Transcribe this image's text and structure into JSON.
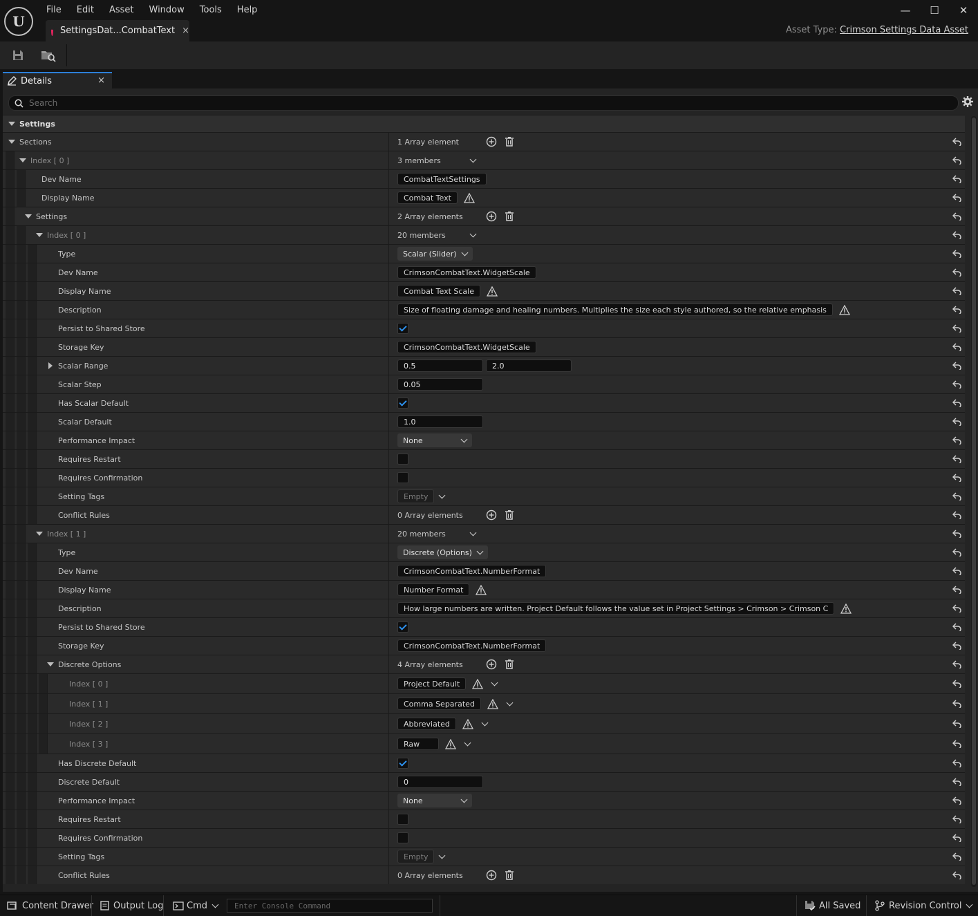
{
  "app": {
    "logo_text": "U",
    "menu": [
      "File",
      "Edit",
      "Asset",
      "Window",
      "Tools",
      "Help"
    ],
    "tab_title": "SettingsDat...CombatText",
    "tab_close": "×",
    "asset_type_label": "Asset Type:",
    "asset_type_value": "Crimson Settings Data Asset",
    "window_minimize": "—",
    "window_maximize": "☐",
    "window_close": "✕"
  },
  "details": {
    "tab_label": "Details",
    "tab_close": "×",
    "search_placeholder": "Search"
  },
  "rows": [
    {
      "depth": 0,
      "name": "Settings",
      "kind": "category",
      "arrow": "down",
      "style": "bold"
    },
    {
      "depth": 0,
      "name": "Sections",
      "arrow": "down",
      "value": {
        "type": "array",
        "text": "1 Array element"
      }
    },
    {
      "depth": 1,
      "name": "Index [ 0 ]",
      "arrow": "down",
      "style": "dim",
      "value": {
        "type": "members",
        "text": "3 members"
      }
    },
    {
      "depth": 2,
      "name": "Dev Name",
      "value": {
        "type": "text",
        "text": "CombatTextSettings"
      }
    },
    {
      "depth": 2,
      "name": "Display Name",
      "value": {
        "type": "text",
        "text": "Combat Text",
        "warn": true
      }
    },
    {
      "depth": 1.5,
      "name": "Settings",
      "arrow": "down",
      "value": {
        "type": "array",
        "text": "2 Array elements"
      }
    },
    {
      "depth": 2.5,
      "name": "Index [ 0 ]",
      "arrow": "down",
      "style": "dim",
      "value": {
        "type": "members",
        "text": "20 members"
      }
    },
    {
      "depth": 3.5,
      "name": "Type",
      "value": {
        "type": "dropdown",
        "text": "Scalar (Slider)"
      }
    },
    {
      "depth": 3.5,
      "name": "Dev Name",
      "value": {
        "type": "text",
        "text": "CrimsonCombatText.WidgetScale"
      }
    },
    {
      "depth": 3.5,
      "name": "Display Name",
      "value": {
        "type": "text",
        "text": "Combat Text Scale",
        "warn": true
      }
    },
    {
      "depth": 3.5,
      "name": "Description",
      "value": {
        "type": "text",
        "text": "Size of floating damage and healing numbers. Multiplies the size each style authored, so the relative emphasis",
        "warn": true
      }
    },
    {
      "depth": 3.5,
      "name": "Persist to Shared Store",
      "value": {
        "type": "check",
        "checked": true
      }
    },
    {
      "depth": 3.5,
      "name": "Storage Key",
      "value": {
        "type": "text",
        "text": "CrimsonCombatText.WidgetScale"
      }
    },
    {
      "depth": 3.5,
      "name": "Scalar Range",
      "arrow": "right",
      "value": {
        "type": "range",
        "min": "0.5",
        "max": "2.0"
      }
    },
    {
      "depth": 3.5,
      "name": "Scalar Step",
      "value": {
        "type": "num",
        "text": "0.05"
      }
    },
    {
      "depth": 3.5,
      "name": "Has Scalar Default",
      "value": {
        "type": "check",
        "checked": true
      }
    },
    {
      "depth": 3.5,
      "name": "Scalar Default",
      "value": {
        "type": "num",
        "text": "1.0"
      }
    },
    {
      "depth": 3.5,
      "name": "Performance Impact",
      "value": {
        "type": "dropdown",
        "text": "None"
      }
    },
    {
      "depth": 3.5,
      "name": "Requires Restart",
      "value": {
        "type": "check",
        "checked": false
      }
    },
    {
      "depth": 3.5,
      "name": "Requires Confirmation",
      "value": {
        "type": "check",
        "checked": false
      }
    },
    {
      "depth": 3.5,
      "name": "Setting Tags",
      "value": {
        "type": "tags",
        "text": "Empty"
      }
    },
    {
      "depth": 3.5,
      "name": "Conflict Rules",
      "value": {
        "type": "array",
        "text": "0 Array elements"
      }
    },
    {
      "depth": 2.5,
      "name": "Index [ 1 ]",
      "arrow": "down",
      "style": "dim",
      "value": {
        "type": "members",
        "text": "20 members"
      }
    },
    {
      "depth": 3.5,
      "name": "Type",
      "value": {
        "type": "dropdown",
        "text": "Discrete (Options)"
      }
    },
    {
      "depth": 3.5,
      "name": "Dev Name",
      "value": {
        "type": "text",
        "text": "CrimsonCombatText.NumberFormat"
      }
    },
    {
      "depth": 3.5,
      "name": "Display Name",
      "value": {
        "type": "text",
        "text": "Number Format",
        "warn": true
      }
    },
    {
      "depth": 3.5,
      "name": "Description",
      "value": {
        "type": "text",
        "text": "How large numbers are written. Project Default follows the value set in Project Settings > Crimson > Crimson C",
        "warn": true
      }
    },
    {
      "depth": 3.5,
      "name": "Persist to Shared Store",
      "value": {
        "type": "check",
        "checked": true
      }
    },
    {
      "depth": 3.5,
      "name": "Storage Key",
      "value": {
        "type": "text",
        "text": "CrimsonCombatText.NumberFormat"
      }
    },
    {
      "depth": 3.5,
      "name": "Discrete Options",
      "arrow": "down",
      "value": {
        "type": "array",
        "text": "4 Array elements"
      }
    },
    {
      "depth": 4.5,
      "name": "Index [ 0 ]",
      "style": "dim",
      "value": {
        "type": "text",
        "text": "Project Default",
        "warn": true,
        "chev": true
      }
    },
    {
      "depth": 4.5,
      "name": "Index [ 1 ]",
      "style": "dim",
      "value": {
        "type": "text",
        "text": "Comma Separated",
        "warn": true,
        "chev": true
      }
    },
    {
      "depth": 4.5,
      "name": "Index [ 2 ]",
      "style": "dim",
      "value": {
        "type": "text",
        "text": "Abbreviated",
        "warn": true,
        "chev": true
      }
    },
    {
      "depth": 4.5,
      "name": "Index [ 3 ]",
      "style": "dim",
      "value": {
        "type": "text",
        "text": "Raw",
        "warn": true,
        "chev": true,
        "width": 60
      }
    },
    {
      "depth": 3.5,
      "name": "Has Discrete Default",
      "value": {
        "type": "check",
        "checked": true
      }
    },
    {
      "depth": 3.5,
      "name": "Discrete Default",
      "value": {
        "type": "num",
        "text": "0"
      }
    },
    {
      "depth": 3.5,
      "name": "Performance Impact",
      "value": {
        "type": "dropdown",
        "text": "None"
      }
    },
    {
      "depth": 3.5,
      "name": "Requires Restart",
      "value": {
        "type": "check",
        "checked": false
      }
    },
    {
      "depth": 3.5,
      "name": "Requires Confirmation",
      "value": {
        "type": "check",
        "checked": false
      }
    },
    {
      "depth": 3.5,
      "name": "Setting Tags",
      "value": {
        "type": "tags",
        "text": "Empty"
      }
    },
    {
      "depth": 3.5,
      "name": "Conflict Rules",
      "value": {
        "type": "array",
        "text": "0 Array elements"
      }
    }
  ],
  "statusbar": {
    "content_drawer": "Content Drawer",
    "output_log": "Output Log",
    "cmd": "Cmd",
    "console_placeholder": "Enter Console Command",
    "all_saved": "All Saved",
    "revision_control": "Revision Control"
  },
  "colors": {
    "accent": "#2d7fd8",
    "asset_icon": "#e0245e",
    "checkbox_check": "#2d8fea"
  }
}
